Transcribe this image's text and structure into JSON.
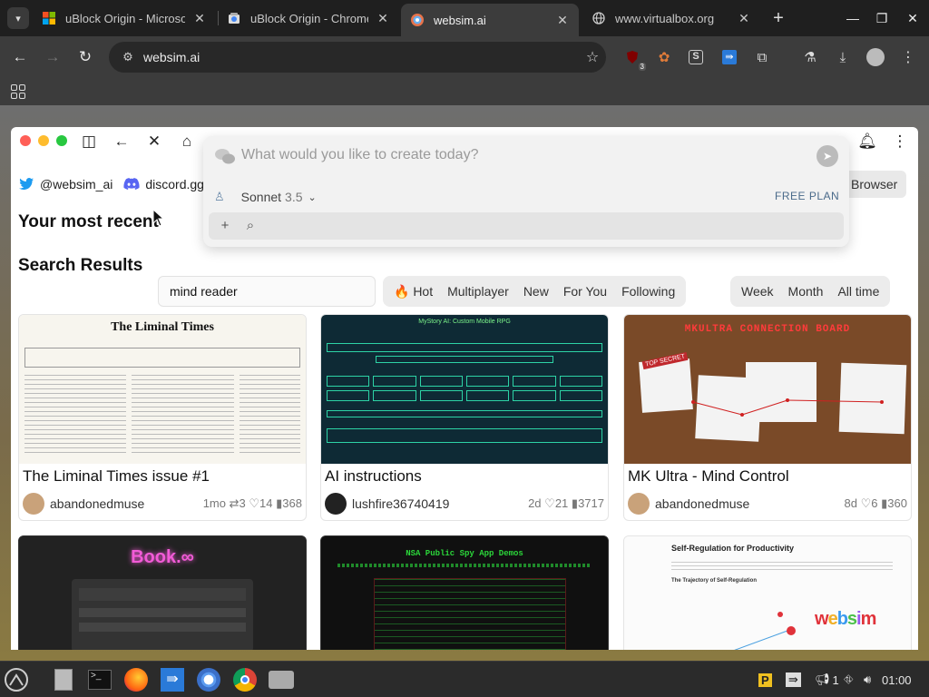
{
  "browser": {
    "tabs": [
      {
        "title": "uBlock Origin - Microso",
        "favicon": "microsoft-icon"
      },
      {
        "title": "uBlock Origin - Chrome",
        "favicon": "chrome-webstore-icon"
      },
      {
        "title": "websim.ai",
        "favicon": "websim-icon"
      },
      {
        "title": "www.virtualbox.org",
        "favicon": "globe-icon"
      }
    ],
    "active_tab": 2,
    "url": "websim.ai",
    "extension_badge": "3"
  },
  "site": {
    "social": [
      {
        "label": "@websim_ai",
        "icon": "twitter-icon"
      },
      {
        "label": "discord.gg",
        "icon": "discord-icon"
      }
    ],
    "browser_button": "Browser",
    "recent_heading": "Your most recent",
    "search_heading": "Search Results",
    "search_value": "mind reader",
    "sort_tabs": [
      "🔥 Hot",
      "Multiplayer",
      "New",
      "For You",
      "Following"
    ],
    "time_tabs": [
      "Week",
      "Month",
      "All time"
    ]
  },
  "prompt": {
    "placeholder": "What would you like to create today?",
    "model": "Sonnet",
    "model_version": "3.5",
    "plan": "FREE PLAN"
  },
  "cards": [
    {
      "title": "The Liminal Times issue #1",
      "user": "abandonedmuse",
      "age": "1mo",
      "remixes": "3",
      "likes": "14",
      "views": "368",
      "thumb_header": "The Liminal Times"
    },
    {
      "title": "AI instructions",
      "user": "lushfire36740419",
      "age": "2d",
      "likes": "21",
      "views": "3717",
      "thumb_header": "MyStory AI: Custom Mobile RPG"
    },
    {
      "title": "MK Ultra - Mind Control",
      "user": "abandonedmuse",
      "age": "8d",
      "likes": "6",
      "views": "360",
      "thumb_header": "MKULTRA CONNECTION BOARD"
    },
    {
      "thumb_header": "Book.∞"
    },
    {
      "thumb_header": "NSA Public Spy App Demos"
    },
    {
      "thumb_header": "Self-Regulation for Productivity",
      "thumb_sub": "The Trajectory of Self-Regulation",
      "thumb_brand": "websim"
    }
  ],
  "taskbar": {
    "clock": "01:00",
    "tray_count": "1"
  },
  "colors": {
    "accent_blue": "#1d9bf0",
    "discord": "#5865f2",
    "dot_red": "#ff5f57",
    "dot_yellow": "#febc2e",
    "dot_green": "#28c840"
  }
}
